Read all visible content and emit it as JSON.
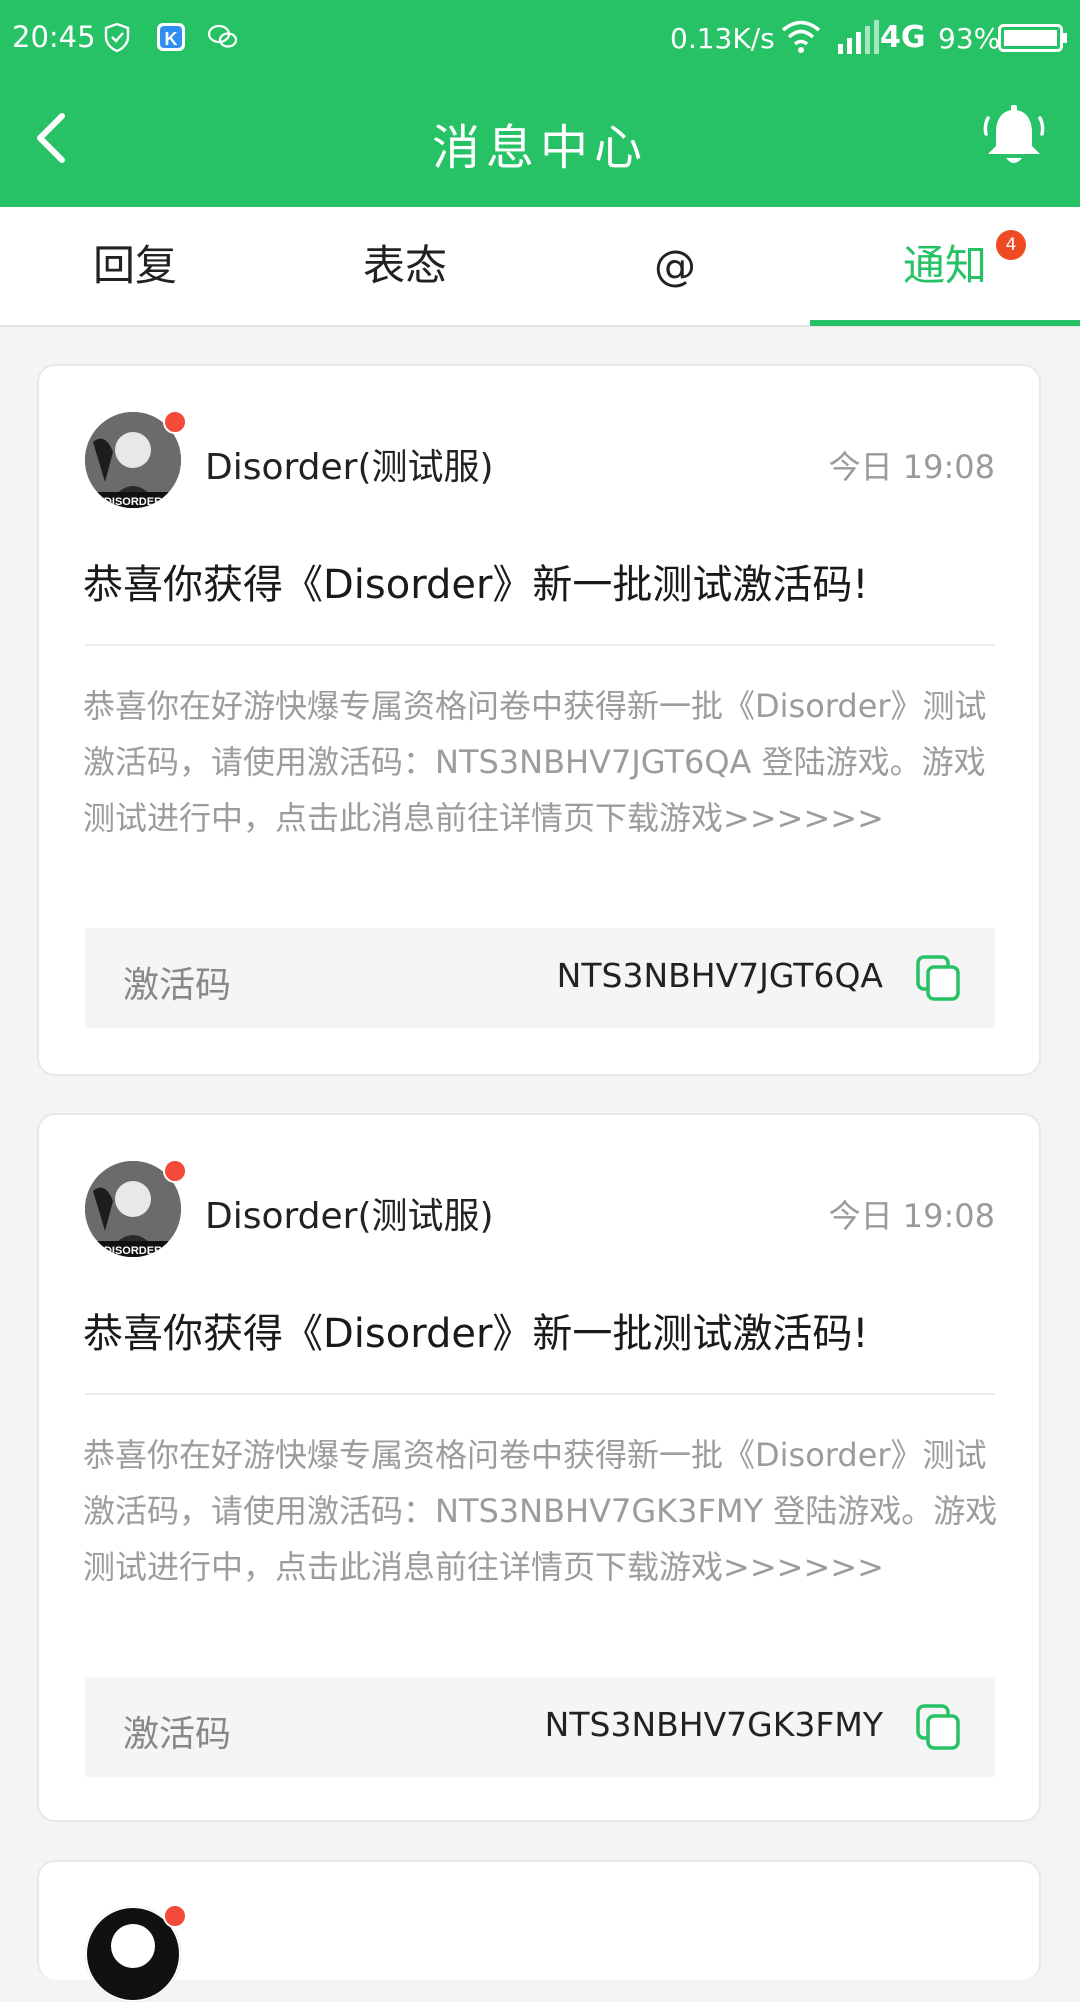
{
  "status_bar": {
    "time": "20:45",
    "net_speed": "0.13K/s",
    "network": "4G",
    "battery": "93%"
  },
  "header": {
    "title": "消息中心"
  },
  "tabs": [
    {
      "label": "回复"
    },
    {
      "label": "表态"
    },
    {
      "label": "@"
    },
    {
      "label": "通知",
      "badge": "4",
      "active": true
    }
  ],
  "messages": [
    {
      "sender": "Disorder(测试服)",
      "time": "今日 19:08",
      "title": "恭喜你获得《Disorder》新一批测试激活码!",
      "body": "恭喜你在好游快爆专属资格问卷中获得新一批《Disorder》测试激活码，请使用激活码：NTS3NBHV7JGT6QA 登陆游戏。游戏测试进行中，点击此消息前往详情页下载游戏>>>>>>",
      "code_label": "激活码",
      "code": "NTS3NBHV7JGT6QA"
    },
    {
      "sender": "Disorder(测试服)",
      "time": "今日 19:08",
      "title": "恭喜你获得《Disorder》新一批测试激活码!",
      "body": "恭喜你在好游快爆专属资格问卷中获得新一批《Disorder》测试激活码，请使用激活码：NTS3NBHV7GK3FMY 登陆游戏。游戏测试进行中，点击此消息前往详情页下载游戏>>>>>>",
      "code_label": "激活码",
      "code": "NTS3NBHV7GK3FMY"
    }
  ],
  "colors": {
    "accent": "#27c166",
    "badge": "#f04a24"
  }
}
